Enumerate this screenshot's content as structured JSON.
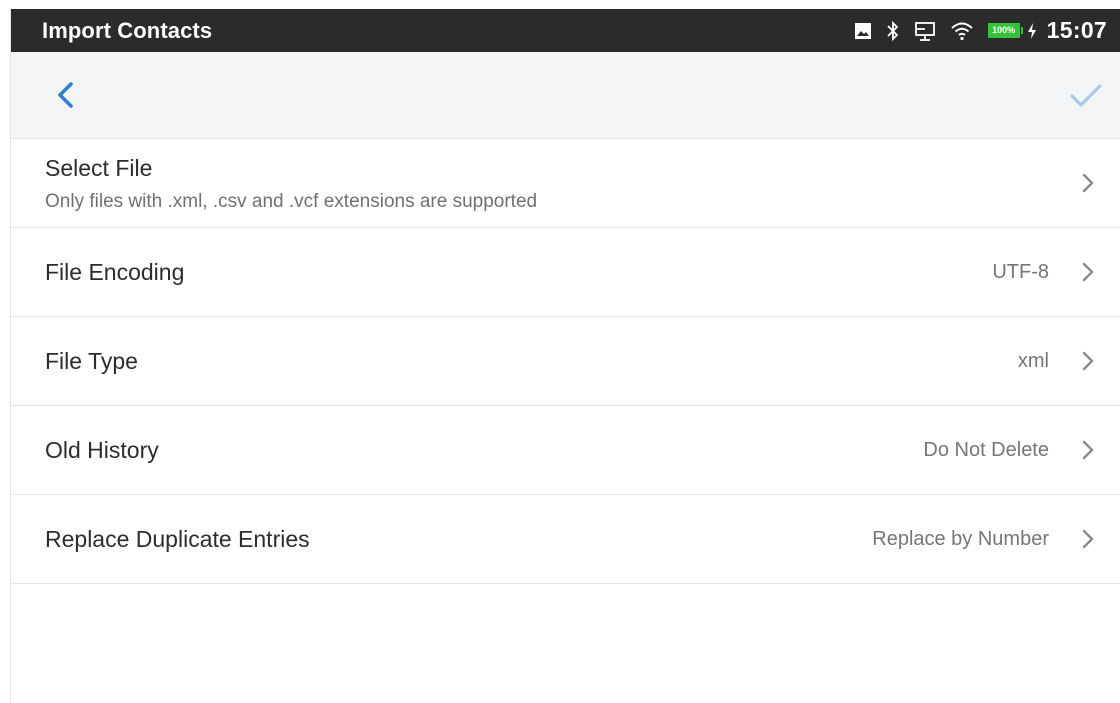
{
  "status_bar": {
    "title": "Import Contacts",
    "battery_text": "100%",
    "time": "15:07",
    "icons": [
      "image-icon",
      "bluetooth-icon",
      "screen-cast-icon",
      "wifi-icon",
      "battery-icon",
      "charging-icon"
    ]
  },
  "toolbar": {
    "back_icon": "chevron-left-icon",
    "confirm_icon": "checkmark-icon",
    "accent_color": "#2f80d1",
    "confirm_color": "#a9c8ea"
  },
  "settings": [
    {
      "title": "Select File",
      "subtitle": "Only files with .xml, .csv and .vcf extensions are supported",
      "value": ""
    },
    {
      "title": "File Encoding",
      "subtitle": "",
      "value": "UTF-8"
    },
    {
      "title": "File Type",
      "subtitle": "",
      "value": "xml"
    },
    {
      "title": "Old History",
      "subtitle": "",
      "value": "Do Not Delete"
    },
    {
      "title": "Replace Duplicate Entries",
      "subtitle": "",
      "value": "Replace by Number"
    }
  ]
}
